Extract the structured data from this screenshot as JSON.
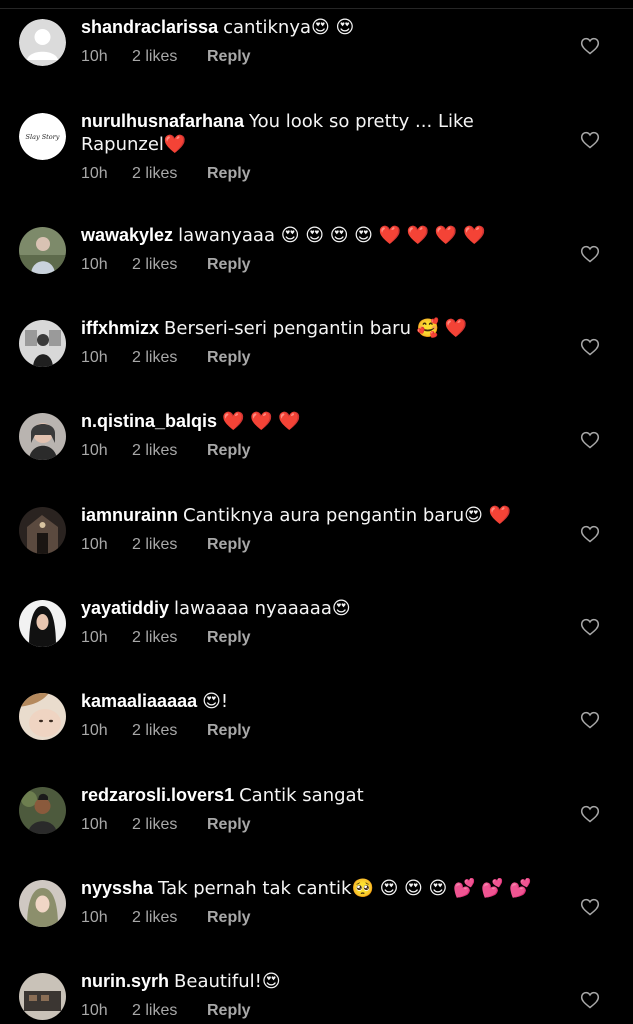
{
  "colors": {
    "background": "#000000",
    "username": "#ffffff",
    "text": "#f5f5f5",
    "meta": "#a8a8a8"
  },
  "comments": [
    {
      "username": "shandraclarissa",
      "text": "cantiknya😍 😍",
      "time": "10h",
      "likes": "2 likes",
      "reply": "Reply",
      "avatar": "default-avatar-icon"
    },
    {
      "username": "nurulhusnafarhana",
      "text": "You look so pretty ... Like Rapunzel❤️",
      "time": "10h",
      "likes": "2 likes",
      "reply": "Reply",
      "avatar": "brand-logo-avatar",
      "avatar_text": "Slay Story"
    },
    {
      "username": "wawakylez",
      "text": "lawanyaaa 😍 😍 😍 😍 ❤️ ❤️ ❤️ ❤️",
      "time": "10h",
      "likes": "2 likes",
      "reply": "Reply",
      "avatar": "photo-avatar"
    },
    {
      "username": "iffxhmizx",
      "text": "Berseri-seri pengantin baru 🥰 ❤️",
      "time": "10h",
      "likes": "2 likes",
      "reply": "Reply",
      "avatar": "photo-avatar"
    },
    {
      "username": "n.qistina_balqis",
      "text": "❤️ ❤️ ❤️",
      "time": "10h",
      "likes": "2 likes",
      "reply": "Reply",
      "avatar": "photo-avatar"
    },
    {
      "username": "iamnurainn",
      "text": "Cantiknya aura pengantin baru😍 ❤️",
      "time": "10h",
      "likes": "2 likes",
      "reply": "Reply",
      "avatar": "photo-avatar"
    },
    {
      "username": "yayatiddiy",
      "text": "lawaaaa nyaaaaa😍",
      "time": "10h",
      "likes": "2 likes",
      "reply": "Reply",
      "avatar": "photo-avatar"
    },
    {
      "username": "kamaaliaaaaa",
      "text": "😍!",
      "time": "10h",
      "likes": "2 likes",
      "reply": "Reply",
      "avatar": "photo-avatar"
    },
    {
      "username": "redzarosli.lovers1",
      "text": "Cantik sangat",
      "time": "10h",
      "likes": "2 likes",
      "reply": "Reply",
      "avatar": "photo-avatar"
    },
    {
      "username": "nyyssha",
      "text": "Tak pernah tak cantik🥺 😍 😍 😍 💕 💕 💕",
      "time": "10h",
      "likes": "2 likes",
      "reply": "Reply",
      "avatar": "photo-avatar"
    },
    {
      "username": "nurin.syrh",
      "text": "Beautiful!😍",
      "time": "10h",
      "likes": "2 likes",
      "reply": "Reply",
      "avatar": "photo-avatar"
    }
  ],
  "like_icon": "heart-outline-icon"
}
